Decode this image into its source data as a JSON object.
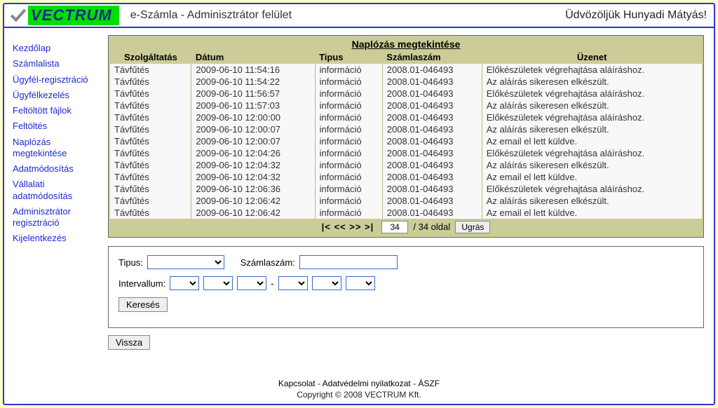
{
  "header": {
    "logo_text": "VECTRUM",
    "title": "e-Számla - Adminisztrátor felület",
    "welcome": "Üdvözöljük Hunyadi Mátyás!"
  },
  "sidebar": {
    "items": [
      "Kezdőlap",
      "Számlalista",
      "Ügyfél-regisztráció",
      "Ügyfélkezelés",
      "Feltöltött fájlok",
      "Feltöltés",
      "Naplózás megtekintése",
      "Adatmódosítás",
      "Vállalati adatmódosítás",
      "Adminisztrátor regisztráció",
      "Kijelentkezés"
    ]
  },
  "panel": {
    "title": "Naplózás megtekintése",
    "columns": [
      "Szolgáltatás",
      "Dátum",
      "Tipus",
      "Számlaszám",
      "Üzenet"
    ],
    "rows": [
      [
        "Távfűtés",
        "2009-06-10 11:54:16",
        "információ",
        "2008.01-046493",
        "Előkészületek végrehajtása aláíráshoz."
      ],
      [
        "Távfűtés",
        "2009-06-10 11:54:22",
        "információ",
        "2008.01-046493",
        "Az aláírás sikeresen elkészült."
      ],
      [
        "Távfűtés",
        "2009-06-10 11:56:57",
        "információ",
        "2008.01-046493",
        "Előkészületek végrehajtása aláíráshoz."
      ],
      [
        "Távfűtés",
        "2009-06-10 11:57:03",
        "információ",
        "2008.01-046493",
        "Az aláírás sikeresen elkészült."
      ],
      [
        "Távfűtés",
        "2009-06-10 12:00:00",
        "információ",
        "2008.01-046493",
        "Előkészületek végrehajtása aláíráshoz."
      ],
      [
        "Távfűtés",
        "2009-06-10 12:00:07",
        "információ",
        "2008.01-046493",
        "Az aláírás sikeresen elkészült."
      ],
      [
        "Távfűtés",
        "2009-06-10 12:00:07",
        "információ",
        "2008.01-046493",
        "Az email el lett küldve."
      ],
      [
        "Távfűtés",
        "2009-06-10 12:04:26",
        "információ",
        "2008.01-046493",
        "Előkészületek végrehajtása aláíráshoz."
      ],
      [
        "Távfűtés",
        "2009-06-10 12:04:32",
        "információ",
        "2008.01-046493",
        "Az aláírás sikeresen elkészült."
      ],
      [
        "Távfűtés",
        "2009-06-10 12:04:32",
        "információ",
        "2008.01-046493",
        "Az email el lett küldve."
      ],
      [
        "Távfűtés",
        "2009-06-10 12:06:36",
        "információ",
        "2008.01-046493",
        "Előkészületek végrehajtása aláíráshoz."
      ],
      [
        "Távfűtés",
        "2009-06-10 12:06:42",
        "információ",
        "2008.01-046493",
        "Az aláírás sikeresen elkészült."
      ],
      [
        "Távfűtés",
        "2009-06-10 12:06:42",
        "információ",
        "2008.01-046493",
        "Az email el lett küldve."
      ]
    ]
  },
  "pager": {
    "controls": "|<  <<  >>  >|",
    "page_value": "34",
    "page_suffix": "/ 34 oldal",
    "go_label": "Ugrás"
  },
  "filter": {
    "type_label": "Tipus:",
    "invoice_label": "Számlaszám:",
    "interval_label": "Intervallum:",
    "dash": "-",
    "search_label": "Keresés"
  },
  "back_label": "Vissza",
  "footer": {
    "links": [
      "Kapcsolat",
      "Adatvédelmi nyilatkozat",
      "ÁSZF"
    ],
    "sep": " - ",
    "copyright": "Copyright © 2008 VECTRUM Kft."
  }
}
